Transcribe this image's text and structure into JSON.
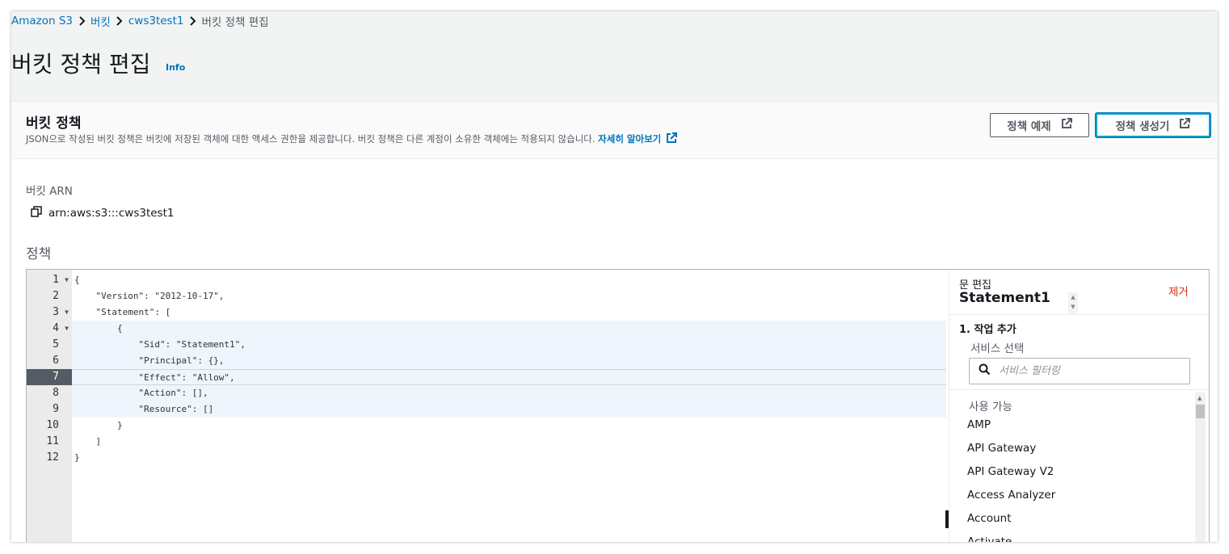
{
  "breadcrumb": {
    "items": [
      "Amazon S3",
      "버킷",
      "cws3test1"
    ],
    "current": "버킷 정책 편집"
  },
  "page": {
    "title": "버킷 정책 편집",
    "info": "Info"
  },
  "panel": {
    "title": "버킷 정책",
    "description": "JSON으로 작성된 버킷 정책은 버킷에 저장된 객체에 대한 액세스 권한을 제공합니다. 버킷 정책은 다른 계정이 소유한 객체에는 적용되지 않습니다.",
    "learn_more": "자세히 알아보기",
    "btn_examples": "정책 예제",
    "btn_generator": "정책 생성기"
  },
  "arn": {
    "label": "버킷 ARN",
    "value": "arn:aws:s3:::cws3test1"
  },
  "policy_label": "정책",
  "editor": {
    "line_numbers": [
      "1",
      "2",
      "3",
      "4",
      "5",
      "6",
      "7",
      "8",
      "9",
      "10",
      "11",
      "12"
    ],
    "lines": [
      "{",
      "    \"Version\": \"2012-10-17\",",
      "    \"Statement\": [",
      "        {",
      "            \"Sid\": \"Statement1\",",
      "            \"Principal\": {},",
      "            \"Effect\": \"Allow\",",
      "            \"Action\": [],",
      "            \"Resource\": []",
      "        }",
      "    ]",
      "}"
    ],
    "active_line": 7
  },
  "statement": {
    "subtitle": "문 편집",
    "name": "Statement1",
    "remove": "제거",
    "step": "1. 작업 추가",
    "service_label": "서비스 선택",
    "filter_placeholder": "서비스 필터링",
    "available_header": "사용 가능",
    "services": [
      "AMP",
      "API Gateway",
      "API Gateway V2",
      "Access Analyzer",
      "Account",
      "Activate"
    ]
  }
}
